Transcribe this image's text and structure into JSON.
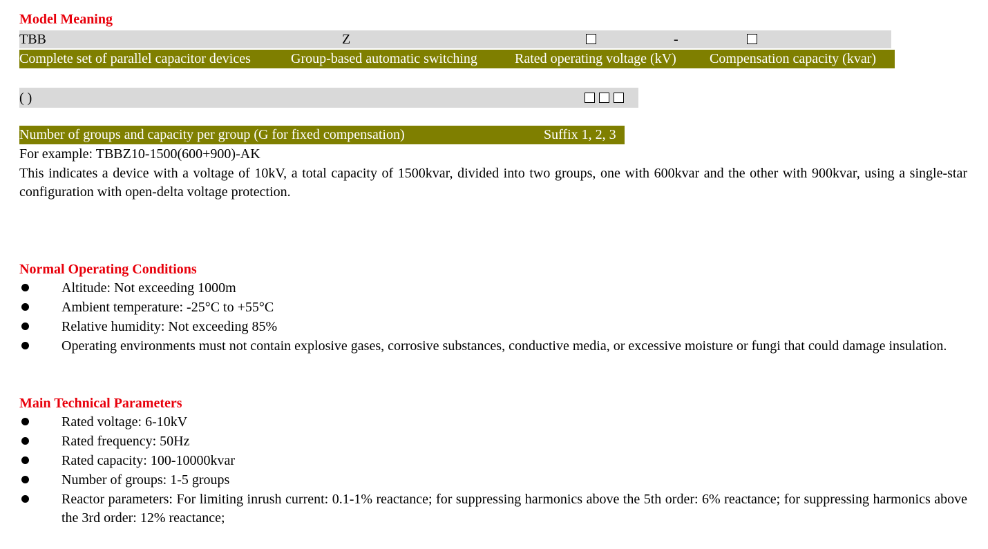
{
  "model_meaning": {
    "heading": "Model Meaning",
    "row1": {
      "prefix": "TBB",
      "z": "Z",
      "dash": "-"
    },
    "row2": {
      "desc1": "Complete set of parallel capacitor devices",
      "desc2": "Group-based automatic switching",
      "desc3": "Rated operating voltage (kV)",
      "desc4": "Compensation capacity (kvar)"
    },
    "row3": {
      "parens": "( )"
    },
    "row4": {
      "desc1": "Number of groups and capacity per group (G for fixed compensation)",
      "desc2": "Suffix 1, 2, 3"
    },
    "example_line": "For example: TBBZ10-1500(600+900)-AK",
    "explanation": "This indicates a device with a voltage of 10kV, a total capacity of 1500kvar, divided into two groups, one with 600kvar and the other with 900kvar, using a single-star configuration with open-delta voltage protection."
  },
  "normal_conditions": {
    "heading": "Normal Operating Conditions",
    "items": [
      "Altitude: Not exceeding 1000m",
      "Ambient temperature: -25°C to +55°C",
      "Relative humidity: Not exceeding 85%",
      "Operating environments must not contain explosive gases, corrosive substances, conductive media, or excessive moisture or fungi that could damage insulation."
    ]
  },
  "main_parameters": {
    "heading": "Main Technical Parameters",
    "items": [
      "Rated voltage: 6-10kV",
      "Rated frequency: 50Hz",
      "Rated capacity: 100-10000kvar",
      "Number of groups: 1-5 groups",
      "Reactor parameters: For limiting inrush current: 0.1-1% reactance; for suppressing harmonics above the 5th order: 6% reactance; for suppressing harmonics above the 3rd order: 12% reactance;"
    ]
  },
  "colors": {
    "heading": "#e8000b",
    "gray_band": "#d9d9d9",
    "olive_band": "#7f7f00"
  }
}
